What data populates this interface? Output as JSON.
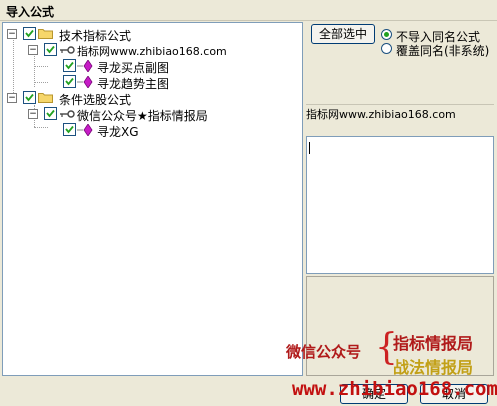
{
  "window": {
    "title": "导入公式"
  },
  "tree": {
    "nodes": [
      {
        "label": "技术指标公式",
        "checked": true,
        "expanded": true,
        "type": "folder"
      },
      {
        "label": "指标网www.zhibiao168.com",
        "checked": true,
        "expanded": true,
        "type": "group"
      },
      {
        "label": "寻龙买点副图",
        "checked": true,
        "type": "formula"
      },
      {
        "label": "寻龙趋势主图",
        "checked": true,
        "type": "formula"
      },
      {
        "label": "条件选股公式",
        "checked": true,
        "expanded": true,
        "type": "folder"
      },
      {
        "label": "微信公众号★指标情报局",
        "checked": true,
        "expanded": true,
        "type": "group"
      },
      {
        "label": "寻龙XG",
        "checked": true,
        "type": "formula"
      }
    ]
  },
  "options": {
    "select_all_label": "全部选中",
    "radio_no_import": "不导入同名公式",
    "radio_overwrite": "覆盖同名(非系统)",
    "selected": "no_import"
  },
  "info": {
    "text": "指标网www.zhibiao168.com"
  },
  "watermark": {
    "left": "微信公众号",
    "right_top": "指标情报局",
    "right_bottom": "战法情报局",
    "url": "www.zhibiao168.com"
  },
  "buttons": {
    "ok": "确定",
    "cancel": "取消"
  },
  "colors": {
    "accent_red": "#b01a1a",
    "accent_gold": "#c2a017",
    "radio_green": "#21a121"
  }
}
